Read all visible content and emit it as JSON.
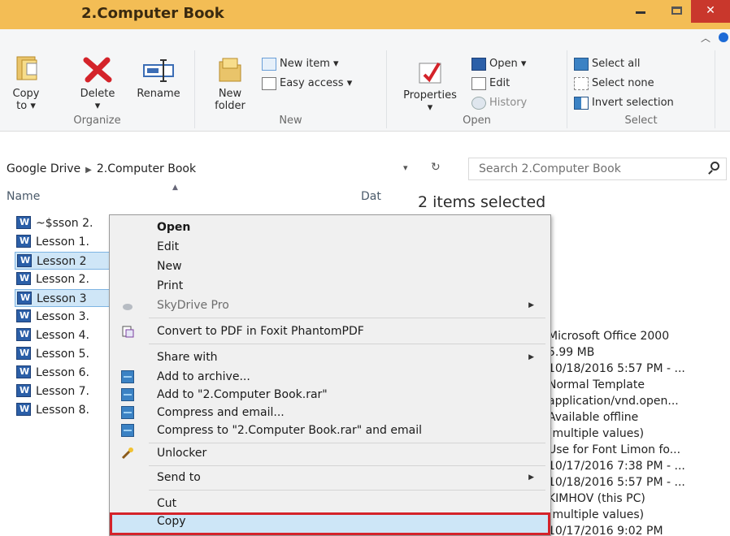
{
  "window": {
    "title": "2.Computer Book"
  },
  "ribbon": {
    "organize": {
      "label": "Organize",
      "copy_to": "Copy to",
      "delete": "Delete",
      "rename": "Rename"
    },
    "new": {
      "label": "New",
      "new_folder": "New folder",
      "new_item": "New item",
      "easy_access": "Easy access"
    },
    "open": {
      "label": "Open",
      "properties": "Properties",
      "open": "Open",
      "edit": "Edit",
      "history": "History"
    },
    "select": {
      "label": "Select",
      "select_all": "Select all",
      "select_none": "Select none",
      "invert_selection": "Invert selection"
    }
  },
  "address": {
    "root": "Google Drive",
    "current": "2.Computer Book",
    "search_placeholder": "Search 2.Computer Book"
  },
  "list": {
    "col_name": "Name",
    "col_date": "Dat",
    "selection_text": "2 items selected",
    "files": [
      {
        "name": "~$sson 2.",
        "selected": false
      },
      {
        "name": "Lesson 1.",
        "selected": false
      },
      {
        "name": "Lesson 2",
        "selected": true
      },
      {
        "name": "Lesson 2.",
        "selected": false
      },
      {
        "name": "Lesson 3",
        "selected": true
      },
      {
        "name": "Lesson 3.",
        "selected": false
      },
      {
        "name": "Lesson 4.",
        "selected": false
      },
      {
        "name": "Lesson 5.",
        "selected": false
      },
      {
        "name": "Lesson 6.",
        "selected": false
      },
      {
        "name": "Lesson 7.",
        "selected": false
      },
      {
        "name": "Lesson 8.",
        "selected": false
      }
    ]
  },
  "details": [
    "Microsoft Office 2000",
    "5.99 MB",
    "10/18/2016 5:57 PM - ...",
    "Normal Template",
    "application/vnd.open...",
    "Available offline",
    "(multiple values)",
    "Use for Font Limon fo...",
    "10/17/2016 7:38 PM - ...",
    "10/18/2016 5:57 PM - ...",
    "KIMHOV (this PC)",
    "(multiple values)",
    "10/17/2016 9:02 PM"
  ],
  "context_menu": {
    "open": "Open",
    "edit": "Edit",
    "new": "New",
    "print": "Print",
    "skydrive_pro": "SkyDrive Pro",
    "convert_pdf": "Convert to PDF in Foxit PhantomPDF",
    "share_with": "Share with",
    "add_archive": "Add to archive...",
    "add_rar": "Add to \"2.Computer Book.rar\"",
    "compress_email": "Compress and email...",
    "compress_rar_email": "Compress to \"2.Computer Book.rar\" and email",
    "unlocker": "Unlocker",
    "send_to": "Send to",
    "cut": "Cut",
    "copy": "Copy"
  },
  "colors": {
    "titlebar": "#f3bd55",
    "close": "#c9372c",
    "selection": "#cfe6f7",
    "highlight_border": "#d4232a"
  }
}
